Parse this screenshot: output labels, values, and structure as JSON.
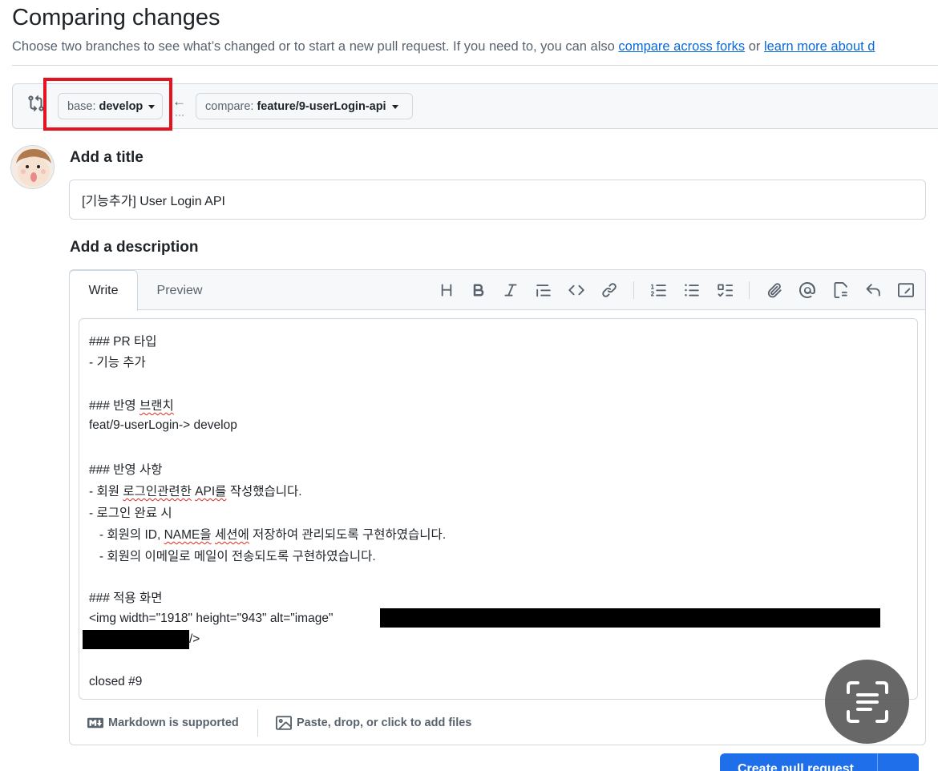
{
  "header": {
    "title": "Comparing changes",
    "subtitle_prefix": "Choose two branches to see what’s changed or to start a new pull request. If you need to, you can also ",
    "compare_forks_link": "compare across forks",
    "subtitle_or": " or ",
    "learn_more_link": "learn more about d"
  },
  "range": {
    "base_prefix": "base:",
    "base_branch": "develop",
    "compare_prefix": "compare:",
    "compare_branch": "feature/9-userLogin-api",
    "arrow": "←",
    "dots": "···"
  },
  "form": {
    "title_label": "Add a title",
    "title_value": "[기능추가] User Login API",
    "description_label": "Add a description"
  },
  "editor": {
    "tabs": {
      "write": "Write",
      "preview": "Preview"
    },
    "lines": {
      "l1": "### PR 타입",
      "l2": "- 기능 추가",
      "l3": "### 반영 ",
      "l3b": "브랜치",
      "l4": "feat/9-userLogin-> develop",
      "l5": "### 반영 사항",
      "l6a": "- 회원 ",
      "l6b": "로그인관련한",
      "l6c": " ",
      "l6d": "API를",
      "l6e": " 작성했습니다.",
      "l7": "- 로그인 완료 시",
      "l8a": "   - 회원의 ID, ",
      "l8b": "NAME을",
      "l8c": " ",
      "l8d": "세션에",
      "l8e": " 저장하여 관리되도록 구현하였습니다.",
      "l9": "   - 회원의 이메일로 메일이 전송되도록 구현하였습니다.",
      "l10": "### 적용 화면",
      "l11": "<img width=\"1918\" height=\"943\" alt=\"image\"",
      "l12": "/>",
      "l13": "closed #9"
    },
    "footer": {
      "markdown": "Markdown is supported",
      "attach": "Paste, drop, or click to add files"
    }
  },
  "actions": {
    "create": "Create pull request"
  },
  "colors": {
    "accent": "#0969da",
    "primary_button": "#1f6feb",
    "highlight": "#e3131f"
  }
}
